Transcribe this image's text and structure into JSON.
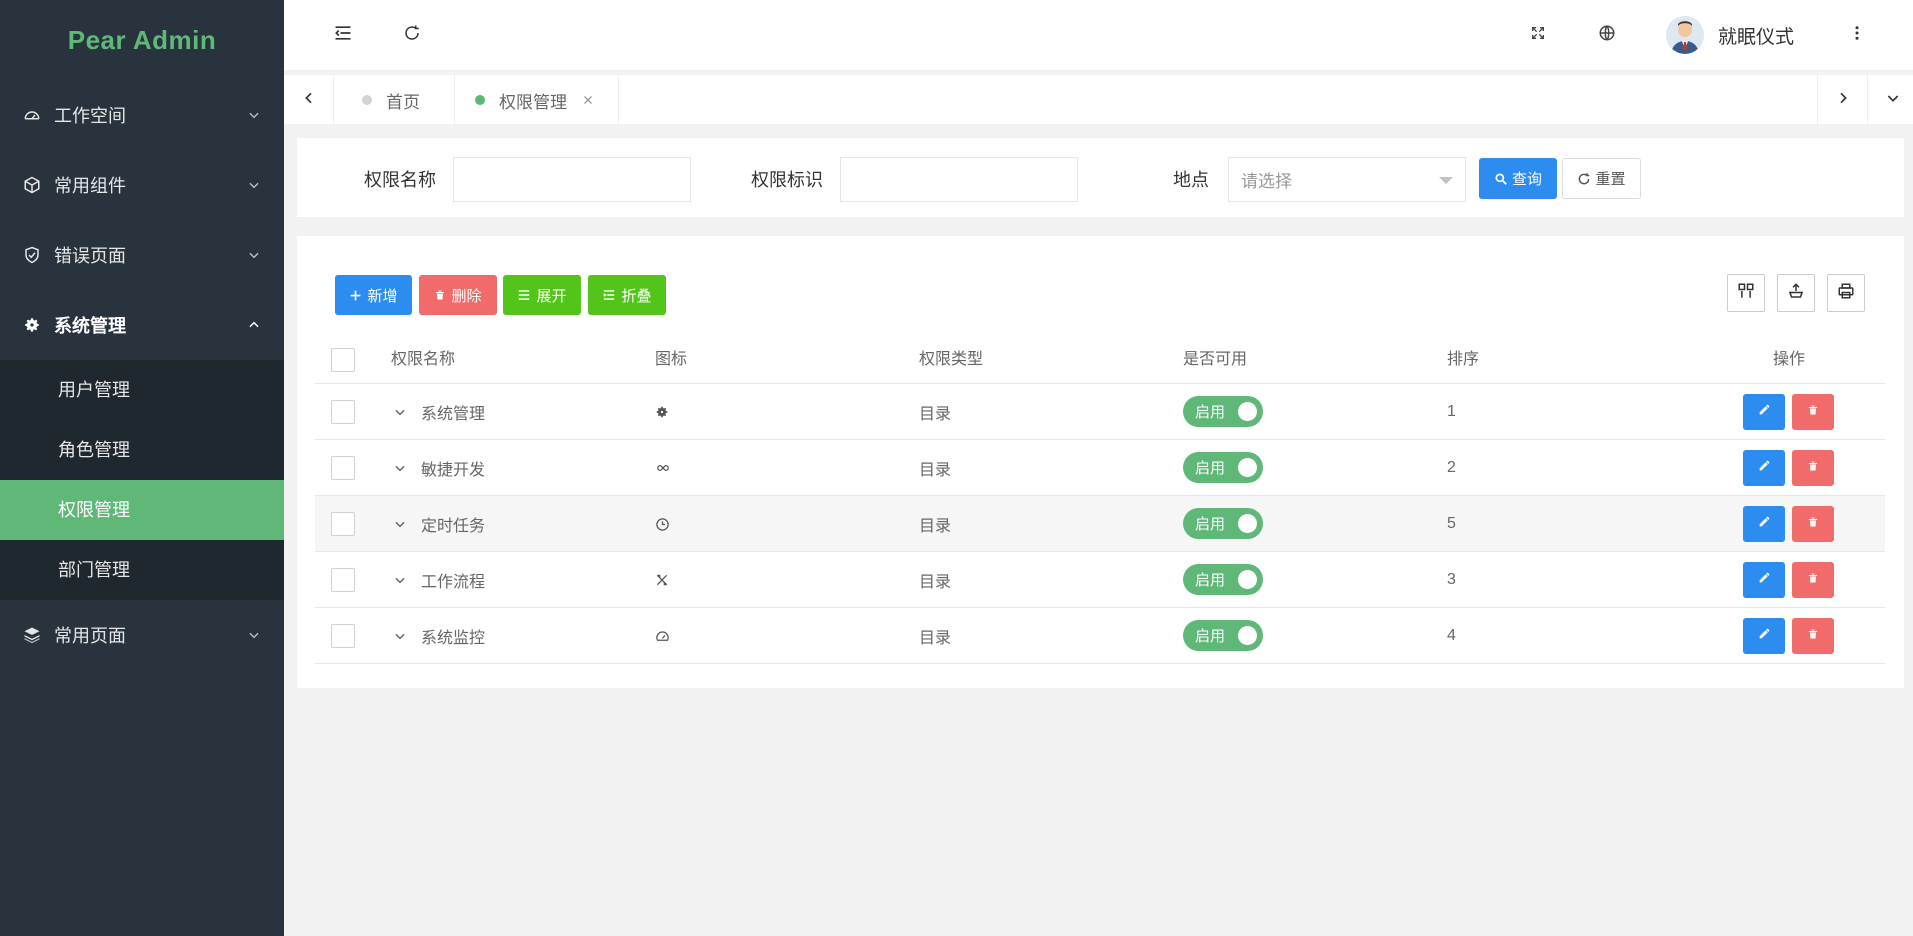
{
  "app": {
    "logo": "Pear Admin"
  },
  "sidebar": {
    "items": [
      {
        "label": "工作空间",
        "icon": "dashboard-icon"
      },
      {
        "label": "常用组件",
        "icon": "box-icon"
      },
      {
        "label": "错误页面",
        "icon": "shield-icon"
      },
      {
        "label": "系统管理",
        "icon": "gear-icon",
        "open": true,
        "children": [
          {
            "label": "用户管理"
          },
          {
            "label": "角色管理"
          },
          {
            "label": "权限管理",
            "active": true
          },
          {
            "label": "部门管理"
          }
        ]
      },
      {
        "label": "常用页面",
        "icon": "layers-icon"
      }
    ]
  },
  "header": {
    "user_name": "就眠仪式"
  },
  "tabs": [
    {
      "label": "首页",
      "active": false
    },
    {
      "label": "权限管理",
      "active": true
    }
  ],
  "search": {
    "name_label": "权限名称",
    "code_label": "权限标识",
    "place_label": "地点",
    "place_placeholder": "请选择",
    "query_label": "查询",
    "reset_label": "重置"
  },
  "toolbar": {
    "add_label": "新增",
    "delete_label": "删除",
    "expand_label": "展开",
    "collapse_label": "折叠"
  },
  "table": {
    "columns": [
      "权限名称",
      "图标",
      "权限类型",
      "是否可用",
      "排序",
      "操作"
    ],
    "rows": [
      {
        "name": "系统管理",
        "icon": "gear-icon",
        "type": "目录",
        "status": "启用",
        "sort": "1"
      },
      {
        "name": "敏捷开发",
        "icon": "infinity-icon",
        "type": "目录",
        "status": "启用",
        "sort": "2"
      },
      {
        "name": "定时任务",
        "icon": "clock-icon",
        "type": "目录",
        "status": "启用",
        "sort": "5"
      },
      {
        "name": "工作流程",
        "icon": "tools-icon",
        "type": "目录",
        "status": "启用",
        "sort": "3"
      },
      {
        "name": "系统监控",
        "icon": "gauge-icon",
        "type": "目录",
        "status": "启用",
        "sort": "4"
      }
    ]
  },
  "colors": {
    "sidebar_bg": "#28333e",
    "accent_green": "#5fb878",
    "primary_blue": "#2d8cf0",
    "danger_red": "#f16b6b",
    "bright_green": "#52c41a"
  }
}
